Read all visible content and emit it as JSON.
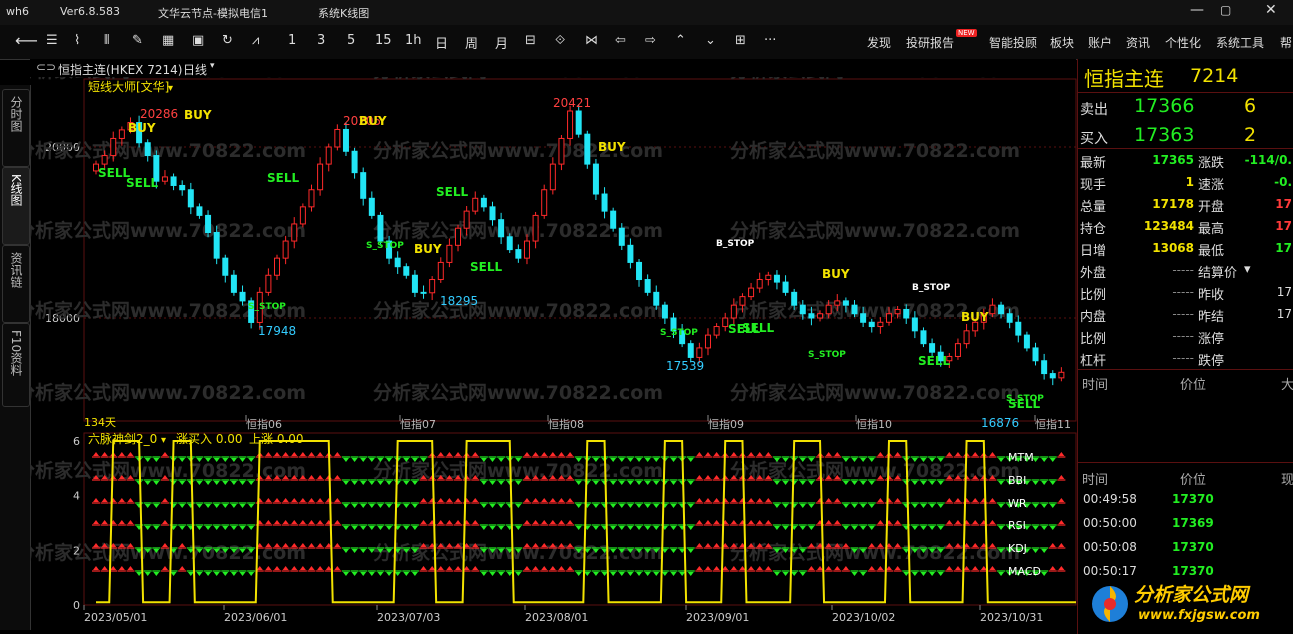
{
  "titlebar": {
    "app": "wh6",
    "version": "Ver6.8.583",
    "node": "文华云节点-模拟电信1",
    "system": "系统K线图"
  },
  "toolbar": {
    "periods": [
      "1",
      "3",
      "5",
      "15",
      "1h",
      "日",
      "周",
      "月"
    ],
    "more": "···",
    "right_menu": [
      {
        "label": "发现"
      },
      {
        "label": "投研报告",
        "badge": "NEW"
      },
      {
        "label": "智能投顾"
      },
      {
        "label": "板块"
      },
      {
        "label": "账户"
      },
      {
        "label": "资讯"
      },
      {
        "label": "个性化"
      },
      {
        "label": "系统工具"
      },
      {
        "label": "帮"
      }
    ]
  },
  "left_nav": [
    {
      "label": "分时图",
      "active": false
    },
    {
      "label": "K线图",
      "active": true
    },
    {
      "label": "资讯链",
      "active": false
    },
    {
      "label": "F10资料",
      "active": false
    }
  ],
  "chart_header": {
    "symbol_icon": "link-icon",
    "title": "恒指主连(HKEX 7214)",
    "period": "日线"
  },
  "watermark": "分析家公式网www.70822.com",
  "indicator_label": "短线大师[文华]",
  "sub_indicator": {
    "name": "六脉神剑2_0",
    "text1": "涨买入 0.00",
    "text2": "上涨 0.00",
    "lines": [
      "MTM",
      "BBI",
      "WR",
      "RSI",
      "KDJ",
      "MACD"
    ]
  },
  "chart_data": [
    {
      "type": "candlestick",
      "ylim": [
        17600,
        20600
      ],
      "y_ticks": [
        20000,
        18000
      ],
      "date_labels": [
        "恒指06",
        "恒指07",
        "恒指08",
        "恒指09",
        "恒指10",
        "恒指11"
      ],
      "count_label": "134天",
      "price_labels": [
        "20286",
        "20205",
        "20421",
        "17948",
        "18295",
        "17539",
        "16876"
      ],
      "signals": [
        "BUY",
        "SELL",
        "B_STOP",
        "S_STOP"
      ],
      "series": [
        {
          "name": "close",
          "values": [
            19800,
            19900,
            20100,
            20200,
            20286,
            20050,
            19900,
            19600,
            19650,
            19550,
            19500,
            19300,
            19200,
            19000,
            18700,
            18500,
            18300,
            18200,
            17948,
            18300,
            18500,
            18700,
            18900,
            19100,
            19300,
            19500,
            19800,
            20000,
            20205,
            19950,
            19700,
            19400,
            19200,
            18900,
            18700,
            18600,
            18500,
            18300,
            18295,
            18450,
            18650,
            18850,
            19050,
            19250,
            19400,
            19300,
            19150,
            18950,
            18800,
            18700,
            18900,
            19200,
            19500,
            19800,
            20100,
            20421,
            20150,
            19800,
            19450,
            19250,
            19050,
            18850,
            18650,
            18450,
            18300,
            18150,
            18000,
            17850,
            17700,
            17539,
            17650,
            17800,
            17900,
            18000,
            18150,
            18250,
            18350,
            18450,
            18500,
            18420,
            18300,
            18150,
            18050,
            18000,
            18050,
            18150,
            18200,
            18150,
            18050,
            17950,
            17900,
            17950,
            18050,
            18100,
            18000,
            17850,
            17700,
            17600,
            17500,
            17550,
            17700,
            17850,
            17950,
            18050,
            18150,
            18050,
            17950,
            17800,
            17650,
            17500,
            17350,
            17300,
            17365
          ]
        }
      ]
    },
    {
      "type": "line",
      "ylim": [
        0,
        6
      ],
      "y_ticks": [
        0,
        2,
        4,
        6
      ],
      "x_tick_labels": [
        "2023/05/01",
        "2023/06/01",
        "2023/07/03",
        "2023/08/01",
        "2023/09/01",
        "2023/10/02",
        "2023/10/31"
      ]
    }
  ],
  "quote": {
    "name": "恒指主连",
    "code": "7214",
    "ask_label": "卖出",
    "ask": "17366",
    "ask_vol": "6",
    "bid_label": "买入",
    "bid": "17363",
    "bid_vol": "2",
    "rows": [
      {
        "l1": "最新",
        "v1": "17365",
        "c1": "grn",
        "l2": "涨跌",
        "v2": "-114/0.",
        "c2": "grn"
      },
      {
        "l1": "现手",
        "v1": "1",
        "c1": "yel",
        "l2": "速涨",
        "v2": "-0.",
        "c2": "grn"
      },
      {
        "l1": "总量",
        "v1": "17178",
        "c1": "yel",
        "l2": "开盘",
        "v2": "17",
        "c2": "red"
      },
      {
        "l1": "持仓",
        "v1": "123484",
        "c1": "yel",
        "l2": "最高",
        "v2": "17",
        "c2": "red"
      },
      {
        "l1": "日增",
        "v1": "13068",
        "c1": "yel",
        "l2": "最低",
        "v2": "17",
        "c2": "grn"
      },
      {
        "l1": "外盘",
        "v1": "-----",
        "c1": "dash",
        "l2": "结算价",
        "v2": "",
        "c2": "lbl"
      },
      {
        "l1": "比例",
        "v1": "-----",
        "c1": "dash",
        "l2": "昨收",
        "v2": "17",
        "c2": "lbl"
      },
      {
        "l1": "内盘",
        "v1": "-----",
        "c1": "dash",
        "l2": "昨结",
        "v2": "17",
        "c2": "lbl"
      },
      {
        "l1": "比例",
        "v1": "-----",
        "c1": "dash",
        "l2": "涨停",
        "v2": "",
        "c2": "lbl"
      },
      {
        "l1": "杠杆",
        "v1": "-----",
        "c1": "dash",
        "l2": "跌停",
        "v2": "",
        "c2": "lbl"
      }
    ],
    "header1": {
      "time": "时间",
      "price": "价位",
      "vol": "大"
    },
    "header2": {
      "time": "时间",
      "price": "价位",
      "vol": "现"
    },
    "ticks": [
      {
        "time": "00:49:58",
        "price": "17370"
      },
      {
        "time": "00:50:00",
        "price": "17369"
      },
      {
        "time": "00:50:08",
        "price": "17370"
      },
      {
        "time": "00:50:17",
        "price": "17370"
      }
    ]
  },
  "logo": {
    "name": "分析家公式网",
    "url": "www.fxjgsw.com"
  },
  "colors": {
    "up": "#ff2a2a",
    "down": "#22e5f5",
    "buy": "#f2e200",
    "sell": "#22ee22",
    "grid": "#5a1010"
  }
}
